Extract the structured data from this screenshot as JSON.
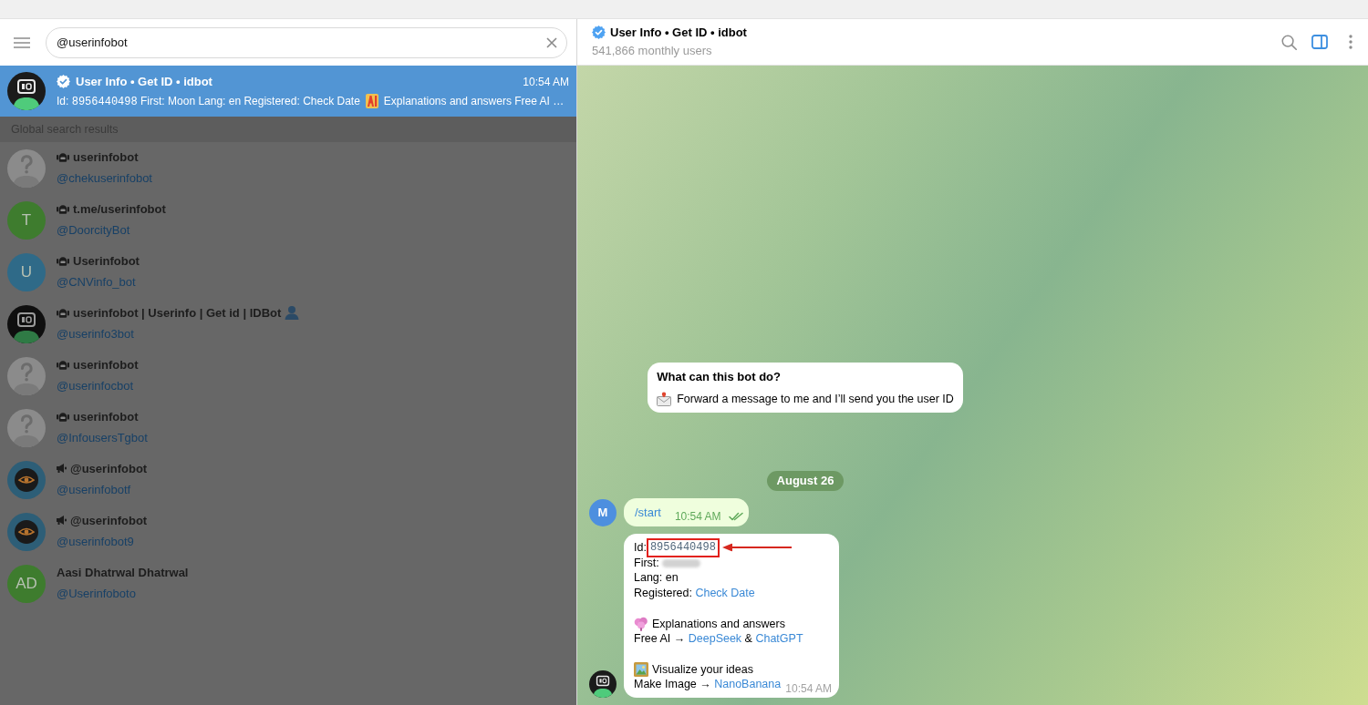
{
  "sidebar": {
    "search": {
      "value": "@userinfobot"
    },
    "chat": {
      "selected": true,
      "title": "User Info • Get ID • idbot",
      "verified": true,
      "time": "10:54 AM",
      "avatar": {
        "kind": "logo"
      },
      "preview": [
        {
          "kind": "text",
          "text": "Id: "
        },
        {
          "kind": "code",
          "text": "8956440498"
        },
        {
          "kind": "text",
          "text": " First: Moon Lang: en Registered: Check Date"
        },
        {
          "kind": "emoji"
        },
        {
          "kind": "text",
          "text": "Explanations and answers Free AI …"
        }
      ]
    },
    "section_title": "Global search results",
    "results": [
      {
        "selected": false,
        "kind": "bot",
        "name": "userinfobot",
        "handle": "@chekuserinfobot",
        "avatar": {
          "kind": "unknown"
        }
      },
      {
        "selected": false,
        "kind": "bot",
        "name": "t.me/userinfobot",
        "handle": "@DoorcityBot",
        "avatar": {
          "kind": "letter",
          "initials": "T",
          "color": "#3e7c2e"
        }
      },
      {
        "selected": false,
        "kind": "bot",
        "name": "Userinfobot",
        "handle": "@CNVinfo_bot",
        "avatar": {
          "kind": "letter",
          "initials": "U",
          "color": "#2f6a88"
        }
      },
      {
        "selected": false,
        "kind": "bot",
        "name": "userinfobot | Userinfo | Get id | IDBot",
        "name_emoji": true,
        "handle": "@userinfo3bot",
        "avatar": {
          "kind": "logo"
        }
      },
      {
        "selected": false,
        "kind": "bot",
        "name": "userinfobot",
        "handle": "@userinfocbot",
        "avatar": {
          "kind": "unknown"
        }
      },
      {
        "selected": false,
        "kind": "bot",
        "name": "userinfobot",
        "handle": "@InfousersTgbot",
        "avatar": {
          "kind": "unknown"
        }
      },
      {
        "selected": false,
        "kind": "channel",
        "name": "@userinfobot",
        "handle": "@userinfobotf",
        "avatar": {
          "kind": "eye"
        }
      },
      {
        "selected": false,
        "kind": "channel",
        "name": "@userinfobot",
        "handle": "@userinfobot9",
        "avatar": {
          "kind": "eye"
        }
      },
      {
        "selected": false,
        "kind": "user",
        "name": "Aasi Dhatrwal Dhatrwal",
        "handle": "@Userinfoboto",
        "avatar": {
          "kind": "letter",
          "initials": "AD",
          "color": "#3e7c2e"
        }
      }
    ]
  },
  "chat": {
    "header": {
      "title": "User Info • Get ID • idbot",
      "verified": true,
      "subtitle": "541,866 monthly users",
      "actions": [
        {
          "kind": "search",
          "active": false
        },
        {
          "kind": "sidebar",
          "active": true
        },
        {
          "kind": "more",
          "active": false
        }
      ]
    },
    "bot_info": {
      "title": "What can this bot do?",
      "text": "Forward a message to me and I’ll send you the user ID"
    },
    "date": "August 26",
    "messages": [
      {
        "kind": "outgoing",
        "avatar": {
          "kind": "letter",
          "initials": "M",
          "color": "#4d8fdf"
        },
        "text": "/start",
        "time": "10:54 AM",
        "read": true
      },
      {
        "kind": "incoming",
        "avatar": {
          "kind": "logo"
        },
        "time": "10:54 AM",
        "paragraphs": [
          [
            [
              {
                "kind": "text",
                "text": "Id:"
              },
              {
                "kind": "code",
                "text": "8956440498",
                "highlighted": true
              }
            ],
            [
              {
                "kind": "text",
                "text": "First: "
              },
              {
                "kind": "blurred"
              }
            ],
            [
              {
                "kind": "text",
                "text": "Lang: en"
              }
            ],
            [
              {
                "kind": "text",
                "text": "Registered: "
              },
              {
                "kind": "link",
                "text": "Check Date"
              }
            ]
          ],
          [
            [
              {
                "kind": "brain"
              },
              {
                "kind": "text",
                "text": "Explanations and answers"
              }
            ],
            [
              {
                "kind": "text",
                "text": "Free AI → "
              },
              {
                "kind": "link",
                "text": "DeepSeek"
              },
              {
                "kind": "text",
                "text": " & "
              },
              {
                "kind": "link",
                "text": "ChatGPT"
              }
            ]
          ],
          [
            [
              {
                "kind": "picture"
              },
              {
                "kind": "text",
                "text": "Visualize your ideas"
              }
            ],
            [
              {
                "kind": "text",
                "text": "Make Image → "
              },
              {
                "kind": "link",
                "text": "NanoBanana"
              }
            ]
          ]
        ]
      }
    ]
  }
}
